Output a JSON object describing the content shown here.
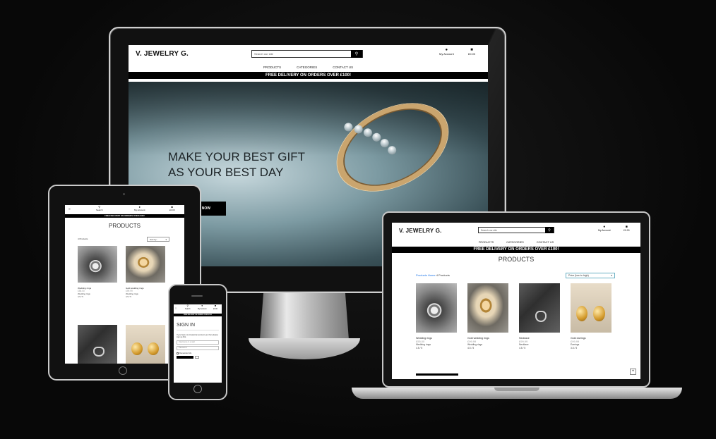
{
  "site": {
    "brand": "V. JEWELRY G.",
    "search_placeholder": "Search our site",
    "account_label": "My Account",
    "bag_total": "£0.00",
    "nav": [
      "PRODUCTS",
      "CATEGORIES",
      "CONTACT US"
    ],
    "banner": "FREE DELIVERY ON ORDERS OVER £100!",
    "search_label": "Search"
  },
  "hero": {
    "line1": "MAKE YOUR BEST GIFT",
    "line2": "AS YOUR BEST DAY",
    "button": "SHOP NOW"
  },
  "products_page": {
    "title": "PRODUCTS",
    "crumb_link": "Products Home",
    "crumb_count": "4 Products",
    "crumb_count_tablet": "4 Products",
    "sort_label": "Price (low to high)",
    "sort_tablet": "Sort by...",
    "items": [
      {
        "name": "Wedding rings",
        "price": "£55.00",
        "category": "Wedding rings",
        "rating": "4.5 / 5"
      },
      {
        "name": "Gold wedding rings",
        "price": "£99.99",
        "category": "Wedding rings",
        "rating": "4.5 / 5"
      },
      {
        "name": "Necklace",
        "price": "£99.99",
        "category": "Necklace",
        "rating": "4.5 / 5"
      },
      {
        "name": "Gold earrings",
        "price": "£99.99",
        "category": "Earrings",
        "rating": "3.8 / 5"
      }
    ]
  },
  "signin": {
    "title": "SIGN IN",
    "intro": "If you have not created an account yet, then please sign up first.",
    "username_placeholder": "Username or e-mail",
    "password_placeholder": "Password",
    "remember": "Remember Me"
  },
  "icons": {
    "search": "magnifier-glyph",
    "account": "person-glyph",
    "bag": "bag-glyph",
    "menu": "hamburger-glyph"
  }
}
